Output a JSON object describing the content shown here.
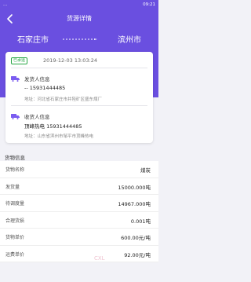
{
  "statusbar": {
    "left": "…",
    "right": "09:21"
  },
  "nav": {
    "title": "货源详情"
  },
  "route": {
    "from": "石家庄市",
    "to": "滨州市"
  },
  "card": {
    "badge": "已承运",
    "timestamp": "2019-12-03 13:03:24",
    "shipper": {
      "title": "发货人信息",
      "phone": "-- 15931444485",
      "address": "地址：河北省石家庄市井陉矿区盛东煤厂"
    },
    "receiver": {
      "title": "收货人信息",
      "phone": "顶峰热电   15931444485",
      "address": "地址：山东省滨州市邹平市顶峰热电"
    }
  },
  "goods": {
    "section_title": "货物信息",
    "rows": [
      {
        "k": "货物名称",
        "v": "煤炭"
      },
      {
        "k": "发货量",
        "v": "15000.000吨"
      },
      {
        "k": "待调度量",
        "v": "14967.000吨"
      },
      {
        "k": "合理货损",
        "v": "0.001吨"
      },
      {
        "k": "货物单价",
        "v": "600.00元/吨"
      },
      {
        "k": "运费单价",
        "v": "92.00元/吨"
      }
    ]
  },
  "colors": {
    "header": "#6a4fe0",
    "badge": "#28a745",
    "truck_icon": "#7a5cf0"
  },
  "watermark": "CXL"
}
